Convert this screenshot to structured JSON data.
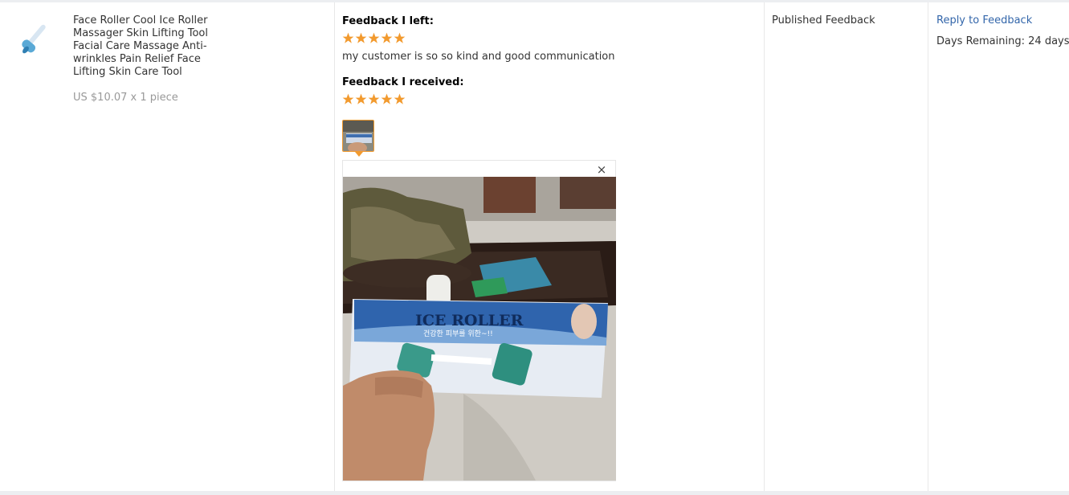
{
  "product": {
    "title": "Face Roller Cool Ice Roller Massager Skin Lifting Tool Facial Care Massage Anti-wrinkles Pain Relief Face Lifting Skin Care Tool",
    "price": "US $10.07 x 1 piece",
    "thumb_icon": "ice-roller-product-image"
  },
  "feedback": {
    "left_heading": "Feedback I left:",
    "left_stars": 5,
    "left_text": "my customer is so so kind and good communication",
    "received_heading": "Feedback I received:",
    "received_stars": 5,
    "close_glyph": "×"
  },
  "photo": {
    "box_brand_text": "ICE ROLLER",
    "box_korean_text": "건강한 피부를 위한~!!"
  },
  "status": {
    "text": "Published Feedback"
  },
  "actions": {
    "reply_label": "Reply to Feedback",
    "days_label": "Days Remaining:",
    "days_value": "24 days"
  },
  "colors": {
    "star": "#f29a2e",
    "link": "#3366aa",
    "thumb_border": "#f29a2e"
  }
}
